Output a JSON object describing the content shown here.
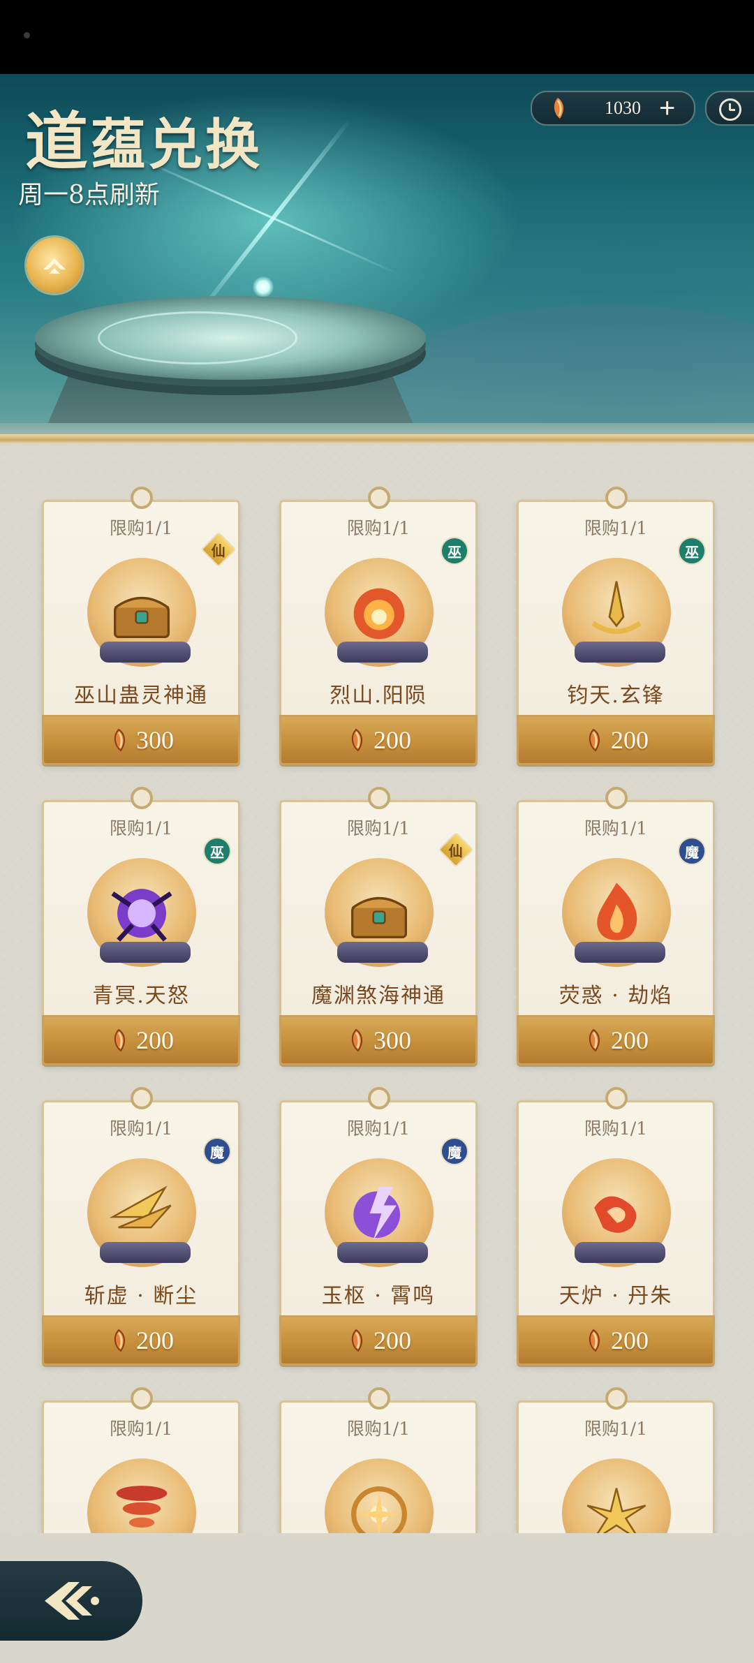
{
  "header": {
    "title_first": "道",
    "title_rest": "蕴兑换",
    "subtitle": "周一8点刷新",
    "emblem_icon": "chevron-up-emblem-icon"
  },
  "currency": {
    "icon": "feather-crystal-icon",
    "amount": "1030",
    "add_label": "+"
  },
  "shop": {
    "items": [
      {
        "limit": "限购1/1",
        "badge": "仙",
        "badge_type": "xian",
        "name": "巫山蛊灵神通",
        "price": "300",
        "art": "chest"
      },
      {
        "limit": "限购1/1",
        "badge": "巫",
        "badge_type": "wu",
        "name": "烈山.阳陨",
        "price": "200",
        "art": "fire"
      },
      {
        "limit": "限购1/1",
        "badge": "巫",
        "badge_type": "wu",
        "name": "钧天.玄锋",
        "price": "200",
        "art": "sword"
      },
      {
        "limit": "限购1/1",
        "badge": "巫",
        "badge_type": "wu",
        "name": "青冥.天怒",
        "price": "200",
        "art": "purple"
      },
      {
        "limit": "限购1/1",
        "badge": "仙",
        "badge_type": "xian",
        "name": "魔渊煞海神通",
        "price": "300",
        "art": "chest"
      },
      {
        "limit": "限购1/1",
        "badge": "魔",
        "badge_type": "mo",
        "name": "荧惑 · 劫焰",
        "price": "200",
        "art": "flame"
      },
      {
        "limit": "限购1/1",
        "badge": "魔",
        "badge_type": "mo",
        "name": "斩虚 · 断尘",
        "price": "200",
        "art": "blades"
      },
      {
        "limit": "限购1/1",
        "badge": "魔",
        "badge_type": "mo",
        "name": "玉枢 · 霄鸣",
        "price": "200",
        "art": "thunder"
      },
      {
        "limit": "限购1/1",
        "badge": "",
        "badge_type": "",
        "name": "天炉 · 丹朱",
        "price": "200",
        "art": "redfire"
      },
      {
        "limit": "限购1/1",
        "badge": "",
        "badge_type": "",
        "name": "",
        "price": "",
        "art": "tornado"
      },
      {
        "limit": "限购1/1",
        "badge": "",
        "badge_type": "",
        "name": "",
        "price": "",
        "art": "burst"
      },
      {
        "limit": "限购1/1",
        "badge": "",
        "badge_type": "",
        "name": "",
        "price": "",
        "art": "spikes"
      }
    ]
  },
  "footer": {
    "back_icon": "back-arrow-icon"
  }
}
